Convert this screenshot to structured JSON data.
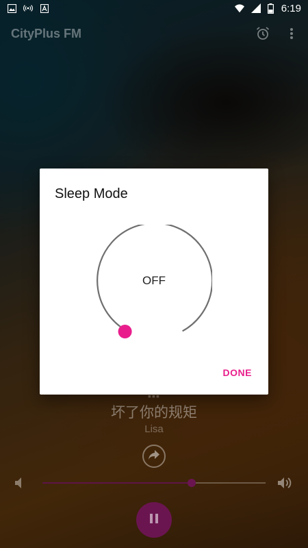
{
  "status_bar": {
    "time": "6:19",
    "left_icons": [
      "image-icon",
      "hotspot-icon",
      "font-icon"
    ],
    "right_icons": [
      "wifi-icon",
      "signal-icon",
      "battery-icon"
    ],
    "battery_level": "6"
  },
  "app_bar": {
    "title": "CityPlus FM",
    "actions": [
      "alarm-icon",
      "more-vert-icon"
    ]
  },
  "now_playing": {
    "song_title": "坏了你的规矩",
    "artist": "Lisa",
    "volume_level": 0.67
  },
  "dialog": {
    "title": "Sleep Mode",
    "dial_value": "OFF",
    "done_label": "DONE"
  },
  "colors": {
    "accent": "#e91e8c",
    "dimmed_accent": "#6a1550",
    "dial_stroke": "#6f6f6f"
  }
}
